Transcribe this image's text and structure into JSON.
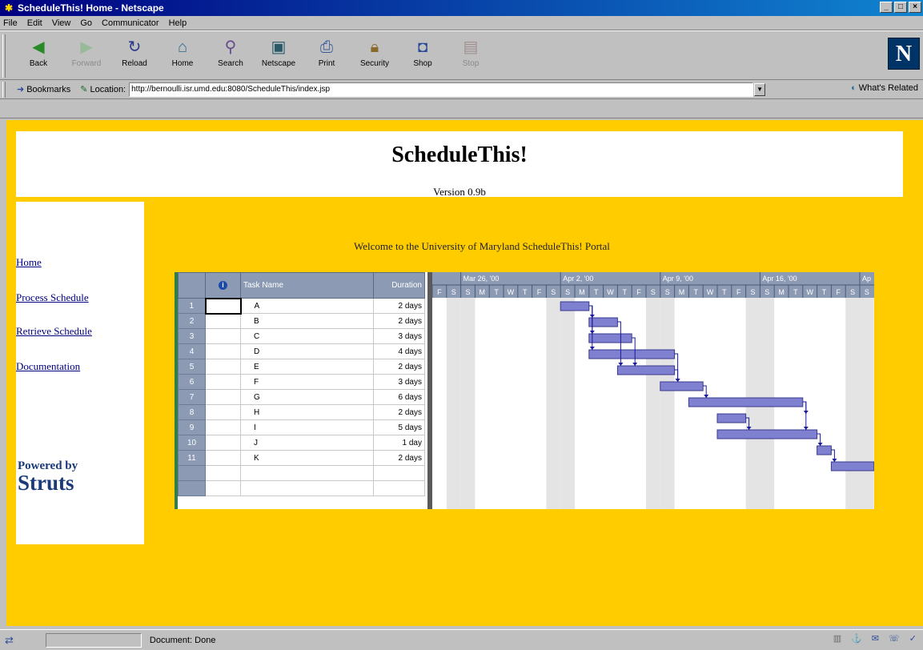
{
  "window": {
    "title": "ScheduleThis! Home - Netscape"
  },
  "menu": [
    "File",
    "Edit",
    "View",
    "Go",
    "Communicator",
    "Help"
  ],
  "toolbar": {
    "buttons": [
      {
        "label": "Back",
        "icon": "back-arrow-icon"
      },
      {
        "label": "Forward",
        "icon": "forward-arrow-icon"
      },
      {
        "label": "Reload",
        "icon": "reload-icon"
      },
      {
        "label": "Home",
        "icon": "home-icon"
      },
      {
        "label": "Search",
        "icon": "search-icon"
      },
      {
        "label": "Netscape",
        "icon": "netscape-icon"
      },
      {
        "label": "Print",
        "icon": "print-icon"
      },
      {
        "label": "Security",
        "icon": "lock-icon"
      },
      {
        "label": "Shop",
        "icon": "shop-icon"
      },
      {
        "label": "Stop",
        "icon": "stop-icon"
      }
    ],
    "logo": "N"
  },
  "location": {
    "bookmarks_label": "Bookmarks",
    "location_label": "Location:",
    "url": "http://bernoulli.isr.umd.edu:8080/ScheduleThis/index.jsp",
    "related_label": "What's Related"
  },
  "page": {
    "title": "ScheduleThis!",
    "version": "Version 0.9b",
    "welcome": "Welcome to the University of Maryland ScheduleThis! Portal",
    "nav": [
      "Home",
      "Process Schedule",
      "Retrieve Schedule",
      "Documentation"
    ],
    "powered_line1": "Powered by",
    "powered_line2": "Struts"
  },
  "gantt": {
    "headers": {
      "task_name": "Task Name",
      "duration": "Duration"
    },
    "tasks": [
      {
        "id": "1",
        "name": "A",
        "duration": "2 days",
        "start": 0,
        "len": 2
      },
      {
        "id": "2",
        "name": "B",
        "duration": "2 days",
        "start": 2,
        "len": 2
      },
      {
        "id": "3",
        "name": "C",
        "duration": "3 days",
        "start": 2,
        "len": 3
      },
      {
        "id": "4",
        "name": "D",
        "duration": "4 days",
        "start": 2,
        "len": 6
      },
      {
        "id": "5",
        "name": "E",
        "duration": "2 days",
        "start": 4,
        "len": 4
      },
      {
        "id": "6",
        "name": "F",
        "duration": "3 days",
        "start": 7,
        "len": 3
      },
      {
        "id": "7",
        "name": "G",
        "duration": "6 days",
        "start": 9,
        "len": 8
      },
      {
        "id": "8",
        "name": "H",
        "duration": "2 days",
        "start": 11,
        "len": 2
      },
      {
        "id": "9",
        "name": "I",
        "duration": "5 days",
        "start": 11,
        "len": 7
      },
      {
        "id": "10",
        "name": "J",
        "duration": "1 day",
        "start": 18,
        "len": 1
      },
      {
        "id": "11",
        "name": "K",
        "duration": "2 days",
        "start": 19,
        "len": 3
      }
    ],
    "weeks": [
      "Mar 26, '00",
      "Apr 2, '00",
      "Apr 9, '00",
      "Apr 16, '00",
      "Ap"
    ],
    "day_letters": [
      "F",
      "S",
      "S",
      "M",
      "T",
      "W",
      "T",
      "F",
      "S",
      "S",
      "M",
      "T",
      "W",
      "T",
      "F",
      "S",
      "S",
      "M",
      "T",
      "W",
      "T",
      "F",
      "S",
      "S",
      "M",
      "T",
      "W",
      "T",
      "F",
      "S",
      "S"
    ],
    "bar_color": "#8080d0",
    "link_color": "#1a1aa0"
  },
  "status": {
    "text": "Document: Done"
  }
}
